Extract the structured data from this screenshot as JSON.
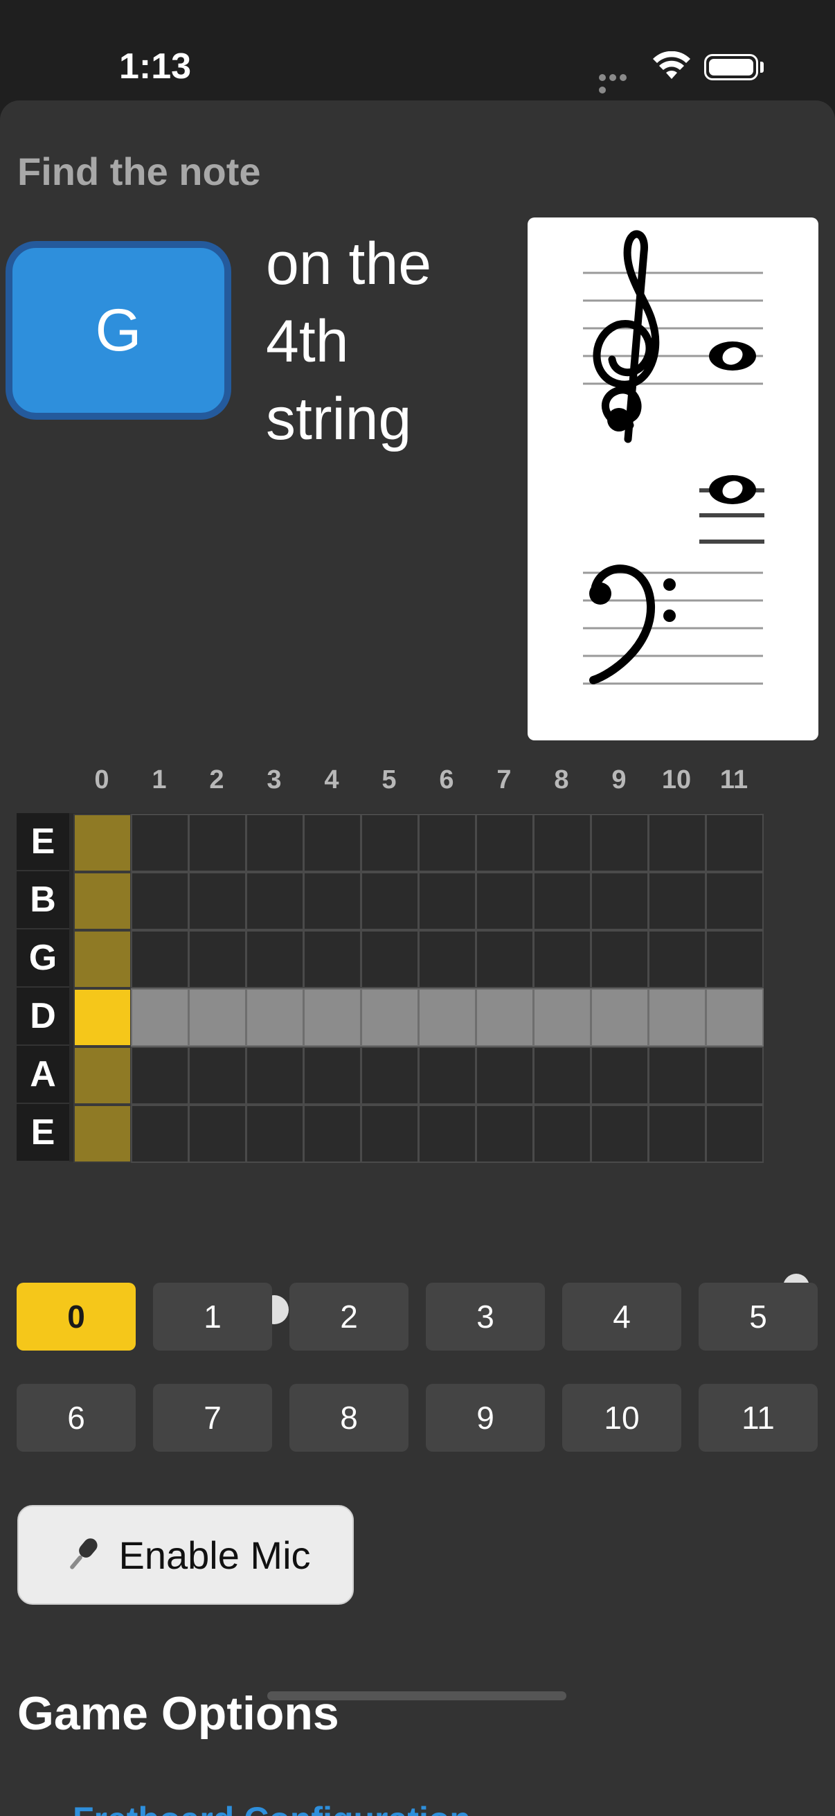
{
  "status_bar": {
    "time": "1:13"
  },
  "prompt": {
    "label": "Find the note",
    "note": "G",
    "target_lines": [
      "on the",
      "4th",
      "string"
    ]
  },
  "fretboard": {
    "fret_numbers": [
      "0",
      "1",
      "2",
      "3",
      "4",
      "5",
      "6",
      "7",
      "8",
      "9",
      "10",
      "11"
    ],
    "strings": [
      "E",
      "B",
      "G",
      "D",
      "A",
      "E"
    ],
    "highlighted_string_index": 3,
    "selected_fret": "0",
    "inlay_frets": [
      3,
      5,
      7,
      9
    ],
    "double_inlay_fret": 12
  },
  "fret_buttons": [
    "0",
    "1",
    "2",
    "3",
    "4",
    "5",
    "6",
    "7",
    "8",
    "9",
    "10",
    "11"
  ],
  "selected_fret_button": "0",
  "mic_button": {
    "label": "Enable Mic",
    "icon": "microphone-icon"
  },
  "game_options": {
    "title": "Game Options",
    "link": "Fretboard Configuration"
  },
  "colors": {
    "accent_blue": "#2e8fdc",
    "accent_yellow": "#f5c71a",
    "open_string": "#8f7a25"
  }
}
